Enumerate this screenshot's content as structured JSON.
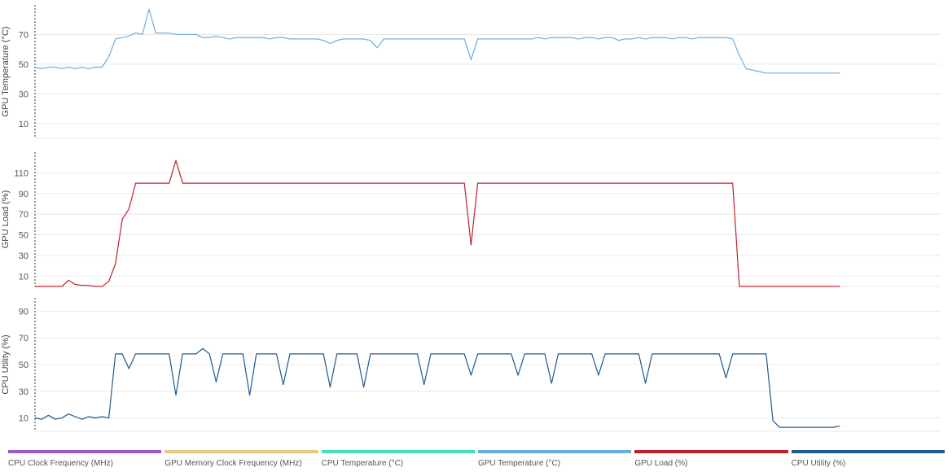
{
  "chart_data": [
    {
      "type": "line",
      "ylabel": "GPU Temperature (°C)",
      "ylim": [
        0,
        90
      ],
      "yticks": [
        10,
        30,
        50,
        70
      ],
      "grid": true,
      "series": [
        {
          "name": "GPU Temperature (°C)",
          "color": "#6aaee0",
          "x": [
            0,
            2,
            4,
            6,
            8,
            10,
            12,
            14,
            16,
            18,
            20,
            22,
            24,
            26,
            28,
            30,
            32,
            34,
            36,
            38,
            40,
            42,
            44,
            46,
            48,
            50,
            52,
            54,
            56,
            58,
            60,
            62,
            64,
            66,
            68,
            70,
            72,
            74,
            76,
            78,
            80,
            82,
            84,
            86,
            88,
            90,
            92,
            94,
            96,
            98,
            100,
            102,
            104,
            106,
            108,
            110,
            112,
            114,
            116,
            118,
            120,
            122,
            124,
            126,
            128,
            130,
            132,
            134,
            136,
            138,
            140,
            142,
            144,
            146,
            148,
            150,
            152,
            154,
            156,
            158,
            160,
            162,
            164,
            166,
            168,
            170,
            172,
            174,
            176,
            178,
            180,
            182,
            184,
            186,
            188,
            190,
            192,
            194,
            196,
            198,
            200,
            202,
            204,
            206,
            208,
            210,
            212,
            214,
            216,
            218,
            220,
            222,
            224,
            226,
            228,
            230,
            232,
            234,
            236,
            238,
            240
          ],
          "values": [
            48,
            47,
            48,
            48,
            47,
            48,
            47,
            48,
            47,
            48,
            48,
            55,
            67,
            68,
            69,
            71,
            70,
            87,
            71,
            71,
            71,
            70,
            70,
            70,
            70,
            68,
            68,
            69,
            68,
            67,
            68,
            68,
            68,
            68,
            68,
            67,
            68,
            68,
            67,
            67,
            67,
            67,
            67,
            66,
            64,
            66,
            67,
            67,
            67,
            67,
            66,
            61,
            67,
            67,
            67,
            67,
            67,
            67,
            67,
            67,
            67,
            67,
            67,
            67,
            67,
            53,
            67,
            67,
            67,
            67,
            67,
            67,
            67,
            67,
            67,
            68,
            67,
            68,
            68,
            68,
            68,
            67,
            68,
            68,
            67,
            68,
            68,
            66,
            67,
            67,
            68,
            67,
            68,
            68,
            68,
            67,
            68,
            68,
            67,
            68,
            68,
            68,
            68,
            68,
            67,
            56,
            47,
            46,
            45,
            44,
            44,
            44,
            44,
            44,
            44,
            44,
            44,
            44,
            44,
            44,
            44
          ]
        }
      ]
    },
    {
      "type": "line",
      "ylabel": "GPU Load (%)",
      "ylim": [
        0,
        130
      ],
      "yticks": [
        10,
        30,
        50,
        70,
        90,
        110
      ],
      "grid": true,
      "series": [
        {
          "name": "GPU Load (%)",
          "color": "#c0202e",
          "x": [
            0,
            2,
            4,
            6,
            8,
            10,
            12,
            14,
            16,
            18,
            20,
            22,
            24,
            26,
            28,
            30,
            32,
            34,
            36,
            38,
            40,
            42,
            44,
            46,
            48,
            50,
            52,
            54,
            56,
            58,
            60,
            62,
            64,
            66,
            68,
            70,
            72,
            74,
            76,
            78,
            80,
            82,
            84,
            86,
            88,
            90,
            92,
            94,
            96,
            98,
            100,
            102,
            104,
            106,
            108,
            110,
            112,
            114,
            116,
            118,
            120,
            122,
            124,
            126,
            128,
            130,
            132,
            134,
            136,
            138,
            140,
            142,
            144,
            146,
            148,
            150,
            152,
            154,
            156,
            158,
            160,
            162,
            164,
            166,
            168,
            170,
            172,
            174,
            176,
            178,
            180,
            182,
            184,
            186,
            188,
            190,
            192,
            194,
            196,
            198,
            200,
            202,
            204,
            206,
            208,
            210,
            212,
            214,
            216,
            218,
            220,
            222,
            224,
            226,
            228,
            230,
            232,
            234,
            236,
            238,
            240
          ],
          "values": [
            0,
            0,
            0,
            0,
            0,
            6,
            2,
            1,
            1,
            0,
            0,
            5,
            22,
            65,
            75,
            100,
            100,
            100,
            100,
            100,
            100,
            122,
            100,
            100,
            100,
            100,
            100,
            100,
            100,
            100,
            100,
            100,
            100,
            100,
            100,
            100,
            100,
            100,
            100,
            100,
            100,
            100,
            100,
            100,
            100,
            100,
            100,
            100,
            100,
            100,
            100,
            100,
            100,
            100,
            100,
            100,
            100,
            100,
            100,
            100,
            100,
            100,
            100,
            100,
            100,
            40,
            100,
            100,
            100,
            100,
            100,
            100,
            100,
            100,
            100,
            100,
            100,
            100,
            100,
            100,
            100,
            100,
            100,
            100,
            100,
            100,
            100,
            100,
            100,
            100,
            100,
            100,
            100,
            100,
            100,
            100,
            100,
            100,
            100,
            100,
            100,
            100,
            100,
            100,
            100,
            0,
            0,
            0,
            0,
            0,
            0,
            0,
            0,
            0,
            0,
            0,
            0,
            0,
            0,
            0,
            0
          ]
        }
      ]
    },
    {
      "type": "line",
      "ylabel": "CPU Utility (%)",
      "ylim": [
        0,
        100
      ],
      "yticks": [
        10,
        30,
        50,
        70,
        90
      ],
      "grid": true,
      "series": [
        {
          "name": "CPU Utility (%)",
          "color": "#1f5a8e",
          "x": [
            0,
            2,
            4,
            6,
            8,
            10,
            12,
            14,
            16,
            18,
            20,
            22,
            24,
            26,
            28,
            30,
            32,
            34,
            36,
            38,
            40,
            42,
            44,
            46,
            48,
            50,
            52,
            54,
            56,
            58,
            60,
            62,
            64,
            66,
            68,
            70,
            72,
            74,
            76,
            78,
            80,
            82,
            84,
            86,
            88,
            90,
            92,
            94,
            96,
            98,
            100,
            102,
            104,
            106,
            108,
            110,
            112,
            114,
            116,
            118,
            120,
            122,
            124,
            126,
            128,
            130,
            132,
            134,
            136,
            138,
            140,
            142,
            144,
            146,
            148,
            150,
            152,
            154,
            156,
            158,
            160,
            162,
            164,
            166,
            168,
            170,
            172,
            174,
            176,
            178,
            180,
            182,
            184,
            186,
            188,
            190,
            192,
            194,
            196,
            198,
            200,
            202,
            204,
            206,
            208,
            210,
            212,
            214,
            216,
            218,
            220,
            222,
            224,
            226,
            228,
            230,
            232,
            234,
            236,
            238,
            240
          ],
          "values": [
            10,
            9,
            12,
            9,
            10,
            13,
            11,
            9,
            11,
            10,
            11,
            10,
            58,
            58,
            47,
            58,
            58,
            58,
            58,
            58,
            58,
            27,
            58,
            58,
            58,
            62,
            58,
            37,
            58,
            58,
            58,
            58,
            27,
            58,
            58,
            58,
            58,
            35,
            58,
            58,
            58,
            58,
            58,
            58,
            33,
            58,
            58,
            58,
            58,
            33,
            58,
            58,
            58,
            58,
            58,
            58,
            58,
            58,
            35,
            58,
            58,
            58,
            58,
            58,
            58,
            42,
            58,
            58,
            58,
            58,
            58,
            58,
            42,
            58,
            58,
            58,
            58,
            36,
            58,
            58,
            58,
            58,
            58,
            58,
            42,
            58,
            58,
            58,
            58,
            58,
            58,
            36,
            58,
            58,
            58,
            58,
            58,
            58,
            58,
            58,
            58,
            58,
            58,
            40,
            58,
            58,
            58,
            58,
            58,
            58,
            8,
            3,
            3,
            3,
            3,
            3,
            3,
            3,
            3,
            3,
            4
          ]
        }
      ]
    }
  ],
  "legend": [
    {
      "label": "CPU Clock Frequency (MHz)",
      "color": "#9b59c6"
    },
    {
      "label": "GPU Memory Clock Frequency (MHz)",
      "color": "#e6c983"
    },
    {
      "label": "CPU Temperature (°C)",
      "color": "#44ddbd"
    },
    {
      "label": "GPU Temperature (°C)",
      "color": "#6aaee0"
    },
    {
      "label": "GPU Load (%)",
      "color": "#c0202e"
    },
    {
      "label": "CPU Utility (%)",
      "color": "#1f5a8e"
    }
  ]
}
